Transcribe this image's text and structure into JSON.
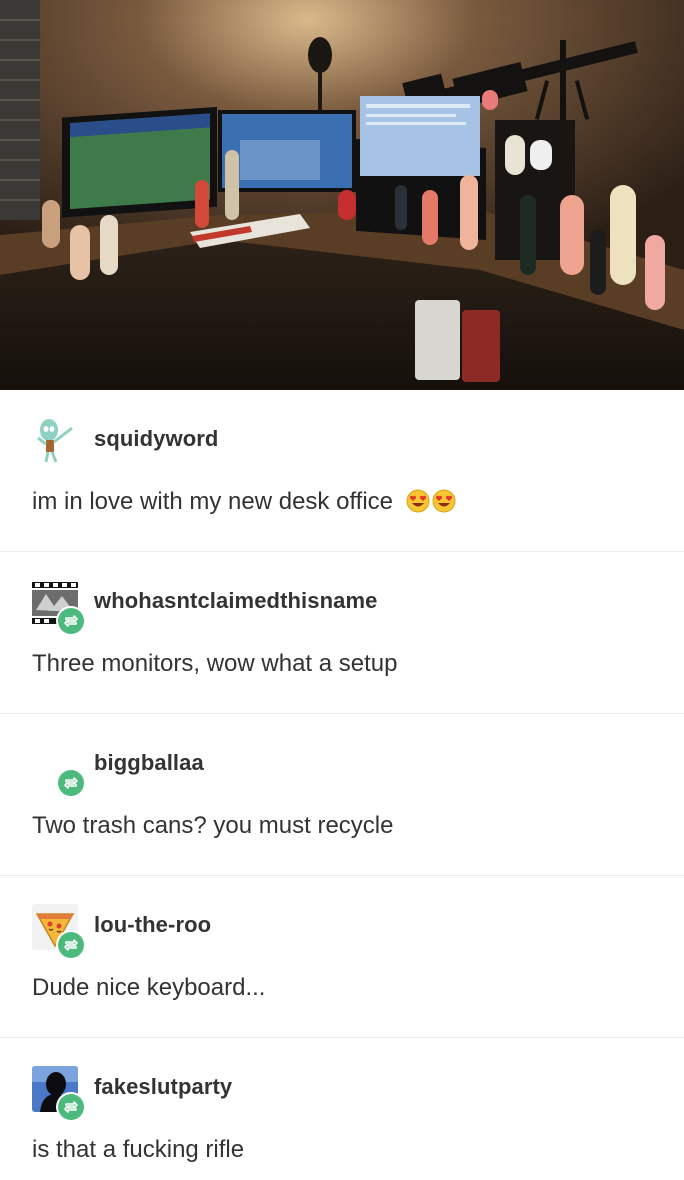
{
  "posts": [
    {
      "username": "squidyword",
      "text": "im in love with my new desk office",
      "emojis": [
        "heart-eyes-emoji",
        "heart-eyes-emoji"
      ],
      "avatar_icon": "squidward-dab-avatar",
      "reblog": false
    },
    {
      "username": "whohasntclaimedthisname",
      "text": "Three monitors, wow what a setup",
      "avatar_icon": "film-strip-avatar",
      "reblog": true
    },
    {
      "username": "biggballaa",
      "text": "Two trash cans? you must recycle",
      "avatar_icon": "blank-avatar",
      "reblog": true
    },
    {
      "username": "lou-the-roo",
      "text": "Dude nice keyboard...",
      "avatar_icon": "pizza-slice-avatar",
      "reblog": true
    },
    {
      "username": "fakeslutparty",
      "text": "is that a fucking rifle",
      "avatar_icon": "silhouette-avatar",
      "reblog": true
    }
  ],
  "colors": {
    "reblog_green": "#4cba7d",
    "text": "#333333",
    "divider": "#ececec"
  },
  "icons": {
    "reblog": "reblog-icon"
  }
}
